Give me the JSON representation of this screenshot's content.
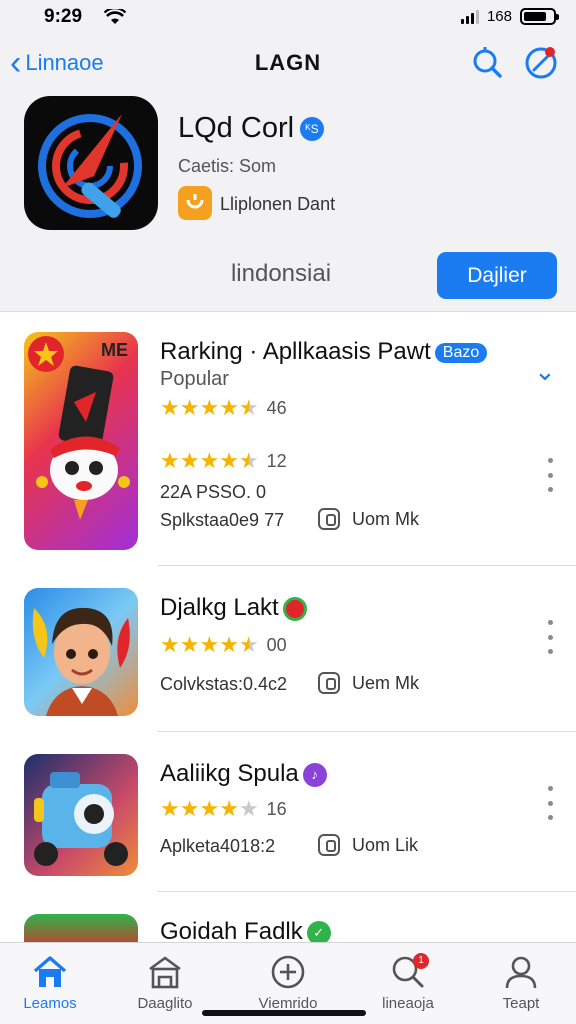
{
  "status": {
    "time": "9:29",
    "battery": "168"
  },
  "nav": {
    "back_label": "Linnaoe",
    "title": "LAGN"
  },
  "app": {
    "name": "LQd Corl",
    "verified_glyph": "ᴷS",
    "subtitle": "Caetis: Som",
    "developer": "Lliplonen Dant",
    "region": "lindonsiai",
    "cta_label": "Dajlier"
  },
  "items": [
    {
      "title": "Rarking · Apllkaasis Pawt",
      "pill": "Bazo",
      "subtitle": "Popular",
      "ratings": [
        {
          "stars": 4.5,
          "count": "46"
        },
        {
          "stars": 4.5,
          "count": "12"
        }
      ],
      "meta1": "22A PSSO. 0",
      "meta2": "Splkstaa0e9 77",
      "meta_right": "Uom Mk",
      "thumb_badge": "ME"
    },
    {
      "title": "Djalkg Lakt",
      "ratings": [
        {
          "stars": 4.5,
          "count": "00"
        }
      ],
      "meta2": "Colvkstas:0.4c2",
      "meta_right": "Uem Mk"
    },
    {
      "title": "Aaliikg Spula",
      "ratings": [
        {
          "stars": 4,
          "count": "16"
        }
      ],
      "meta2": "Aplketa4018:2",
      "meta_right": "Uom Lik"
    },
    {
      "title": "Goidah Fadlk"
    }
  ],
  "tabs": [
    {
      "label": "Leamos",
      "icon": "home-icon",
      "active": true
    },
    {
      "label": "Daaglito",
      "icon": "store-icon"
    },
    {
      "label": "Viemrido",
      "icon": "add-circle-icon"
    },
    {
      "label": "lineaoja",
      "icon": "search-person-icon",
      "badge": "1"
    },
    {
      "label": "Teapt",
      "icon": "person-icon"
    }
  ],
  "colors": {
    "accent": "#1a7cf0",
    "star": "#f4b400",
    "notification": "#e2252b"
  }
}
